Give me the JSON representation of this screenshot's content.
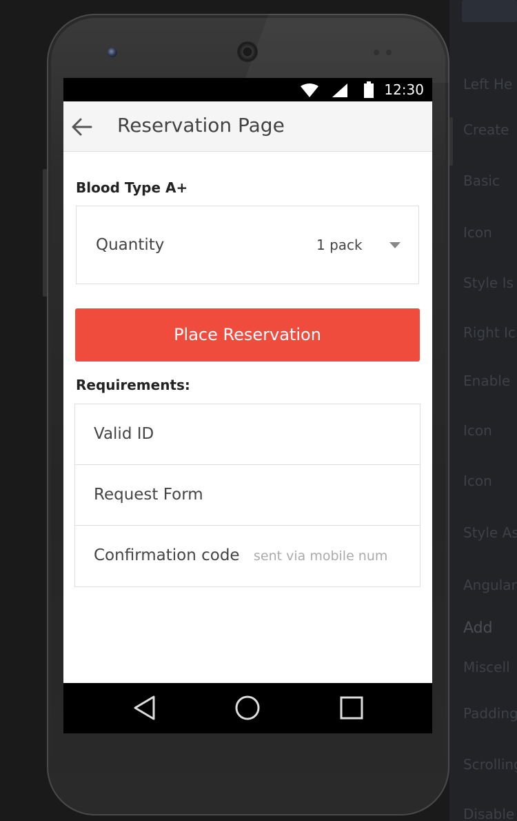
{
  "background_panel": {
    "items": [
      "Left He",
      "Create",
      "Basic",
      "Icon",
      "Style Is",
      "Right Ic",
      "Enable",
      "Icon",
      "Icon",
      "Style As",
      "Angular",
      "Add",
      "Miscell",
      "Padding",
      "Scrolling",
      "Disable"
    ]
  },
  "statusbar": {
    "time": "12:30",
    "icons": [
      "wifi-icon",
      "signal-icon",
      "battery-icon"
    ]
  },
  "appbar": {
    "back_icon": "arrow-left-icon",
    "title": "Reservation Page"
  },
  "form": {
    "blood_type_label": "Blood Type A+",
    "quantity_label": "Quantity",
    "quantity_value": "1 pack",
    "reserve_button": "Place Reservation"
  },
  "requirements": {
    "title": "Requirements:",
    "items": [
      {
        "name": "Valid ID",
        "hint": ""
      },
      {
        "name": "Request Form",
        "hint": ""
      },
      {
        "name": "Confirmation code",
        "hint": "sent via mobile num"
      }
    ]
  },
  "navbar": {
    "icons": [
      "back-triangle-icon",
      "home-circle-icon",
      "recents-square-icon"
    ]
  },
  "colors": {
    "accent": "#ef4c3d",
    "appbar_bg": "#f5f5f5",
    "screen_bg": "#ffffff",
    "device_body": "#2c2c2c"
  }
}
